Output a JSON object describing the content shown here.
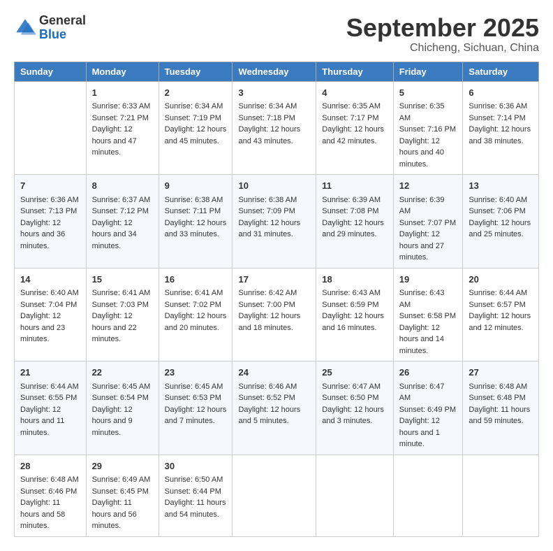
{
  "logo": {
    "general": "General",
    "blue": "Blue"
  },
  "title": "September 2025",
  "subtitle": "Chicheng, Sichuan, China",
  "days_of_week": [
    "Sunday",
    "Monday",
    "Tuesday",
    "Wednesday",
    "Thursday",
    "Friday",
    "Saturday"
  ],
  "weeks": [
    [
      {
        "day": "",
        "sunrise": "",
        "sunset": "",
        "daylight": ""
      },
      {
        "day": "1",
        "sunrise": "Sunrise: 6:33 AM",
        "sunset": "Sunset: 7:21 PM",
        "daylight": "Daylight: 12 hours and 47 minutes."
      },
      {
        "day": "2",
        "sunrise": "Sunrise: 6:34 AM",
        "sunset": "Sunset: 7:19 PM",
        "daylight": "Daylight: 12 hours and 45 minutes."
      },
      {
        "day": "3",
        "sunrise": "Sunrise: 6:34 AM",
        "sunset": "Sunset: 7:18 PM",
        "daylight": "Daylight: 12 hours and 43 minutes."
      },
      {
        "day": "4",
        "sunrise": "Sunrise: 6:35 AM",
        "sunset": "Sunset: 7:17 PM",
        "daylight": "Daylight: 12 hours and 42 minutes."
      },
      {
        "day": "5",
        "sunrise": "Sunrise: 6:35 AM",
        "sunset": "Sunset: 7:16 PM",
        "daylight": "Daylight: 12 hours and 40 minutes."
      },
      {
        "day": "6",
        "sunrise": "Sunrise: 6:36 AM",
        "sunset": "Sunset: 7:14 PM",
        "daylight": "Daylight: 12 hours and 38 minutes."
      }
    ],
    [
      {
        "day": "7",
        "sunrise": "Sunrise: 6:36 AM",
        "sunset": "Sunset: 7:13 PM",
        "daylight": "Daylight: 12 hours and 36 minutes."
      },
      {
        "day": "8",
        "sunrise": "Sunrise: 6:37 AM",
        "sunset": "Sunset: 7:12 PM",
        "daylight": "Daylight: 12 hours and 34 minutes."
      },
      {
        "day": "9",
        "sunrise": "Sunrise: 6:38 AM",
        "sunset": "Sunset: 7:11 PM",
        "daylight": "Daylight: 12 hours and 33 minutes."
      },
      {
        "day": "10",
        "sunrise": "Sunrise: 6:38 AM",
        "sunset": "Sunset: 7:09 PM",
        "daylight": "Daylight: 12 hours and 31 minutes."
      },
      {
        "day": "11",
        "sunrise": "Sunrise: 6:39 AM",
        "sunset": "Sunset: 7:08 PM",
        "daylight": "Daylight: 12 hours and 29 minutes."
      },
      {
        "day": "12",
        "sunrise": "Sunrise: 6:39 AM",
        "sunset": "Sunset: 7:07 PM",
        "daylight": "Daylight: 12 hours and 27 minutes."
      },
      {
        "day": "13",
        "sunrise": "Sunrise: 6:40 AM",
        "sunset": "Sunset: 7:06 PM",
        "daylight": "Daylight: 12 hours and 25 minutes."
      }
    ],
    [
      {
        "day": "14",
        "sunrise": "Sunrise: 6:40 AM",
        "sunset": "Sunset: 7:04 PM",
        "daylight": "Daylight: 12 hours and 23 minutes."
      },
      {
        "day": "15",
        "sunrise": "Sunrise: 6:41 AM",
        "sunset": "Sunset: 7:03 PM",
        "daylight": "Daylight: 12 hours and 22 minutes."
      },
      {
        "day": "16",
        "sunrise": "Sunrise: 6:41 AM",
        "sunset": "Sunset: 7:02 PM",
        "daylight": "Daylight: 12 hours and 20 minutes."
      },
      {
        "day": "17",
        "sunrise": "Sunrise: 6:42 AM",
        "sunset": "Sunset: 7:00 PM",
        "daylight": "Daylight: 12 hours and 18 minutes."
      },
      {
        "day": "18",
        "sunrise": "Sunrise: 6:43 AM",
        "sunset": "Sunset: 6:59 PM",
        "daylight": "Daylight: 12 hours and 16 minutes."
      },
      {
        "day": "19",
        "sunrise": "Sunrise: 6:43 AM",
        "sunset": "Sunset: 6:58 PM",
        "daylight": "Daylight: 12 hours and 14 minutes."
      },
      {
        "day": "20",
        "sunrise": "Sunrise: 6:44 AM",
        "sunset": "Sunset: 6:57 PM",
        "daylight": "Daylight: 12 hours and 12 minutes."
      }
    ],
    [
      {
        "day": "21",
        "sunrise": "Sunrise: 6:44 AM",
        "sunset": "Sunset: 6:55 PM",
        "daylight": "Daylight: 12 hours and 11 minutes."
      },
      {
        "day": "22",
        "sunrise": "Sunrise: 6:45 AM",
        "sunset": "Sunset: 6:54 PM",
        "daylight": "Daylight: 12 hours and 9 minutes."
      },
      {
        "day": "23",
        "sunrise": "Sunrise: 6:45 AM",
        "sunset": "Sunset: 6:53 PM",
        "daylight": "Daylight: 12 hours and 7 minutes."
      },
      {
        "day": "24",
        "sunrise": "Sunrise: 6:46 AM",
        "sunset": "Sunset: 6:52 PM",
        "daylight": "Daylight: 12 hours and 5 minutes."
      },
      {
        "day": "25",
        "sunrise": "Sunrise: 6:47 AM",
        "sunset": "Sunset: 6:50 PM",
        "daylight": "Daylight: 12 hours and 3 minutes."
      },
      {
        "day": "26",
        "sunrise": "Sunrise: 6:47 AM",
        "sunset": "Sunset: 6:49 PM",
        "daylight": "Daylight: 12 hours and 1 minute."
      },
      {
        "day": "27",
        "sunrise": "Sunrise: 6:48 AM",
        "sunset": "Sunset: 6:48 PM",
        "daylight": "Daylight: 11 hours and 59 minutes."
      }
    ],
    [
      {
        "day": "28",
        "sunrise": "Sunrise: 6:48 AM",
        "sunset": "Sunset: 6:46 PM",
        "daylight": "Daylight: 11 hours and 58 minutes."
      },
      {
        "day": "29",
        "sunrise": "Sunrise: 6:49 AM",
        "sunset": "Sunset: 6:45 PM",
        "daylight": "Daylight: 11 hours and 56 minutes."
      },
      {
        "day": "30",
        "sunrise": "Sunrise: 6:50 AM",
        "sunset": "Sunset: 6:44 PM",
        "daylight": "Daylight: 11 hours and 54 minutes."
      },
      {
        "day": "",
        "sunrise": "",
        "sunset": "",
        "daylight": ""
      },
      {
        "day": "",
        "sunrise": "",
        "sunset": "",
        "daylight": ""
      },
      {
        "day": "",
        "sunrise": "",
        "sunset": "",
        "daylight": ""
      },
      {
        "day": "",
        "sunrise": "",
        "sunset": "",
        "daylight": ""
      }
    ]
  ]
}
